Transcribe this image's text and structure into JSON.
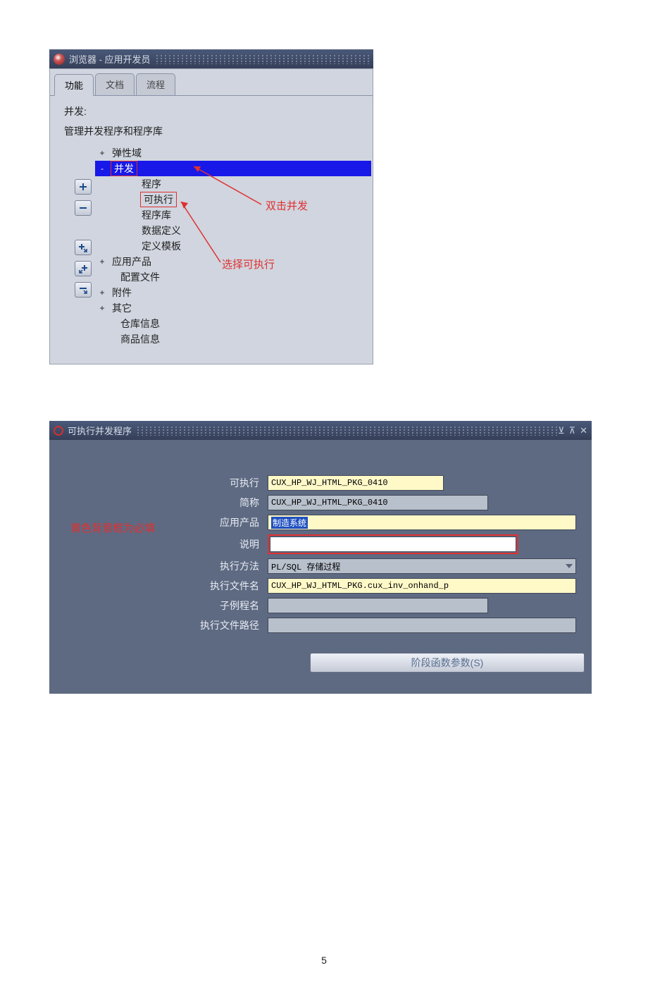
{
  "window1": {
    "title": "浏览器 - 应用开发员",
    "tabs": [
      "功能",
      "文档",
      "流程"
    ],
    "active_tab": 0,
    "breadcrumb1": "并发:",
    "breadcrumb2": "管理并发程序和程序库",
    "tree": [
      {
        "level": 1,
        "expander": "+",
        "label": "弹性域"
      },
      {
        "level": 1,
        "expander": "-",
        "label": "并发",
        "highlight": true,
        "redbox": true
      },
      {
        "level": 2,
        "label": "程序"
      },
      {
        "level": 2,
        "label": "可执行",
        "redbox": true
      },
      {
        "level": 2,
        "label": "程序库"
      },
      {
        "level": 2,
        "label": "数据定义"
      },
      {
        "level": 2,
        "label": "定义模板"
      },
      {
        "level": 1,
        "expander": "+",
        "label": "应用产品"
      },
      {
        "level": 2,
        "label": "配置文件"
      },
      {
        "level": 1,
        "expander": "+",
        "label": "附件"
      },
      {
        "level": 1,
        "expander": "+",
        "label": "其它"
      },
      {
        "level": 2,
        "label": "仓库信息"
      },
      {
        "level": 2,
        "label": "商品信息"
      }
    ],
    "anno1": "双击并发",
    "anno2": "选择可执行"
  },
  "window2": {
    "title": "可执行并发程序",
    "note": "黄色背景框为必填",
    "fields": {
      "executable_label": "可执行",
      "executable_value": "CUX_HP_WJ_HTML_PKG_0410",
      "shortname_label": "简称",
      "shortname_value": "CUX_HP_WJ_HTML_PKG_0410",
      "app_label": "应用产品",
      "app_value": "制造系统",
      "desc_label": "说明",
      "desc_value": "",
      "method_label": "执行方法",
      "method_value": "PL/SQL 存储过程",
      "filename_label": "执行文件名",
      "filename_value": "CUX_HP_WJ_HTML_PKG.cux_inv_onhand_p",
      "subproc_label": "子例程名",
      "subproc_value": "",
      "filepath_label": "执行文件路径",
      "filepath_value": ""
    },
    "button": "阶段函数参数(S)"
  },
  "page": "5"
}
